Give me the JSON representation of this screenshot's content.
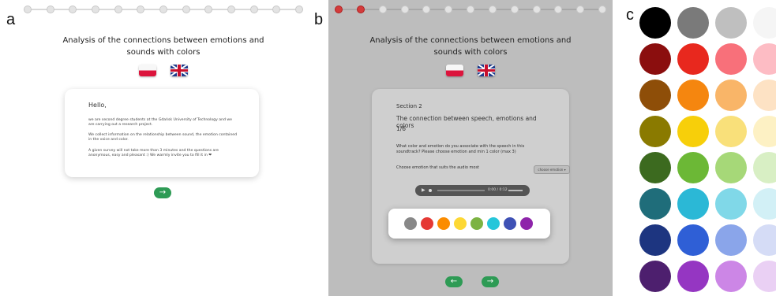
{
  "labels": {
    "a": "a",
    "b": "b",
    "c": "c"
  },
  "title_line1": "Analysis of the connections between emotions and",
  "title_line2": "sounds with colors",
  "panel_a": {
    "hello": "Hello,",
    "p1": "we are second degree students at the Gdańsk University of Technology and we are carrying out a research project.",
    "p2": "We collect information on the relationship between sound, the emotion contained in the voice and color.",
    "p3": "A given survey will not take more than 3 minutes and the questions are anonymous, easy and pleasant :) We warmly invite you to fill it in ❤",
    "next_icon": "→"
  },
  "panel_b": {
    "section": "Section 2",
    "heading": "The connection between speech, emotions and colors",
    "counter": "1/6",
    "question": "What color and emotion do you associate with the speech in this soundtrack? Please choose emotion and min 1 color (max 3)",
    "choose_label": "Choose emotion that suits the audio most",
    "select_value": "choose emotion ▾",
    "audio_time": "0:00 / 0:12",
    "play_icon": "▶",
    "prev_icon": "←",
    "next_icon": "→",
    "palette_colors": [
      "#888888",
      "#e53935",
      "#fb8c00",
      "#fdd835",
      "#7cb342",
      "#26c6da",
      "#3f51b5",
      "#8e24aa"
    ]
  },
  "panel_c": {
    "rows": [
      [
        "#000000",
        "#7a7a7a",
        "#bfbfbf",
        "#f5f5f5"
      ],
      [
        "#8b0e0e",
        "#e8281e",
        "#f8707a",
        "#fdbcc4"
      ],
      [
        "#8e4e08",
        "#f5860f",
        "#f9b568",
        "#fde2c4"
      ],
      [
        "#8a7a00",
        "#f7cf0a",
        "#f9e07a",
        "#fdf1c4"
      ],
      [
        "#3c6a1f",
        "#6cb836",
        "#a6d878",
        "#d8efc4"
      ],
      [
        "#1f6d7a",
        "#2bb8d6",
        "#80d8e8",
        "#d2f0f6"
      ],
      [
        "#1d3580",
        "#2f5fd6",
        "#8aa5ea",
        "#d5dcf6"
      ],
      [
        "#4d1f6e",
        "#9536c2",
        "#cc86e6",
        "#ead0f4"
      ]
    ]
  }
}
